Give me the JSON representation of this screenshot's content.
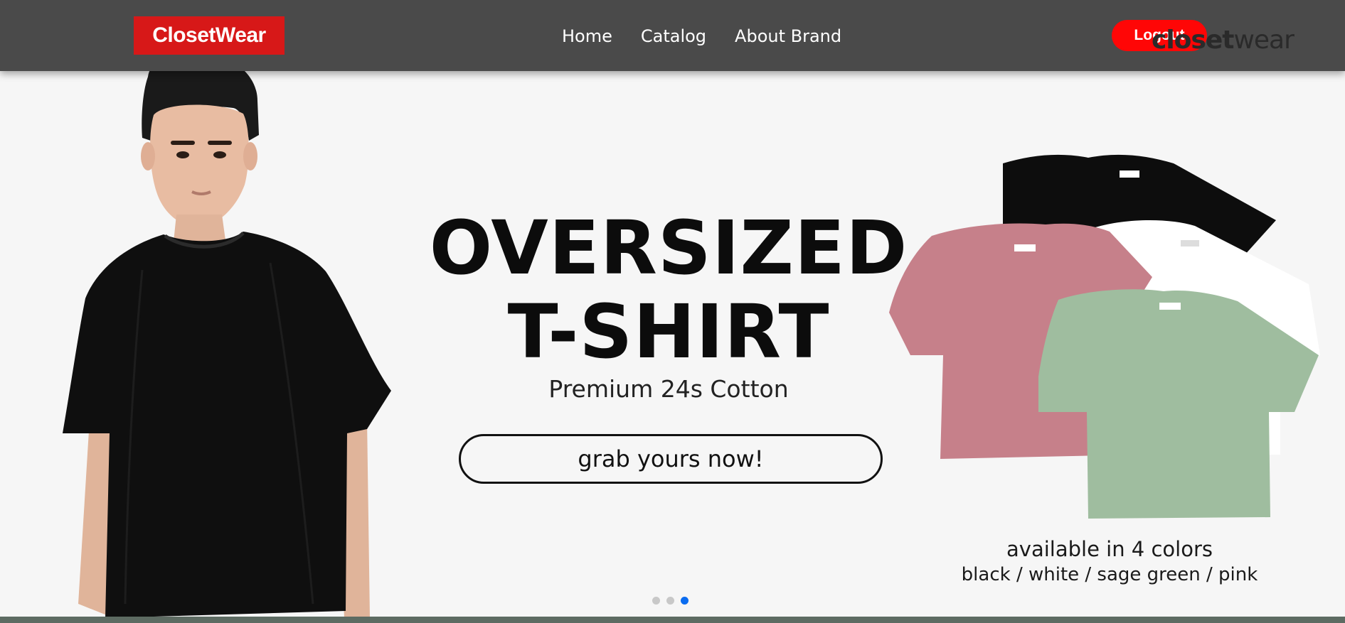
{
  "navbar": {
    "brand": "ClosetWear",
    "links": [
      "Home",
      "Catalog",
      "About Brand"
    ],
    "logout_label": "Logout",
    "watermark_light": "closet",
    "watermark_regular": "wear"
  },
  "hero": {
    "headline_line1": "OVERSIZED",
    "headline_line2": "T-SHIRT",
    "subtitle": "Premium 24s Cotton",
    "cta_label": "grab yours now!",
    "available_text": "available in 4 colors",
    "colors_text": "black / white / sage green / pink",
    "shirt_colors": [
      "#0d0d0d",
      "#ffffff",
      "#9fbd9f",
      "#c6808a"
    ]
  },
  "carousel": {
    "slide_count": 3,
    "active_slide": 3
  },
  "colors": {
    "navbar_bg": "#4a4a4a",
    "brand_bg": "#d71818",
    "logout_bg": "#ff0606",
    "hero_bg": "#f6f6f6",
    "active_dot": "#0a6cf0"
  }
}
